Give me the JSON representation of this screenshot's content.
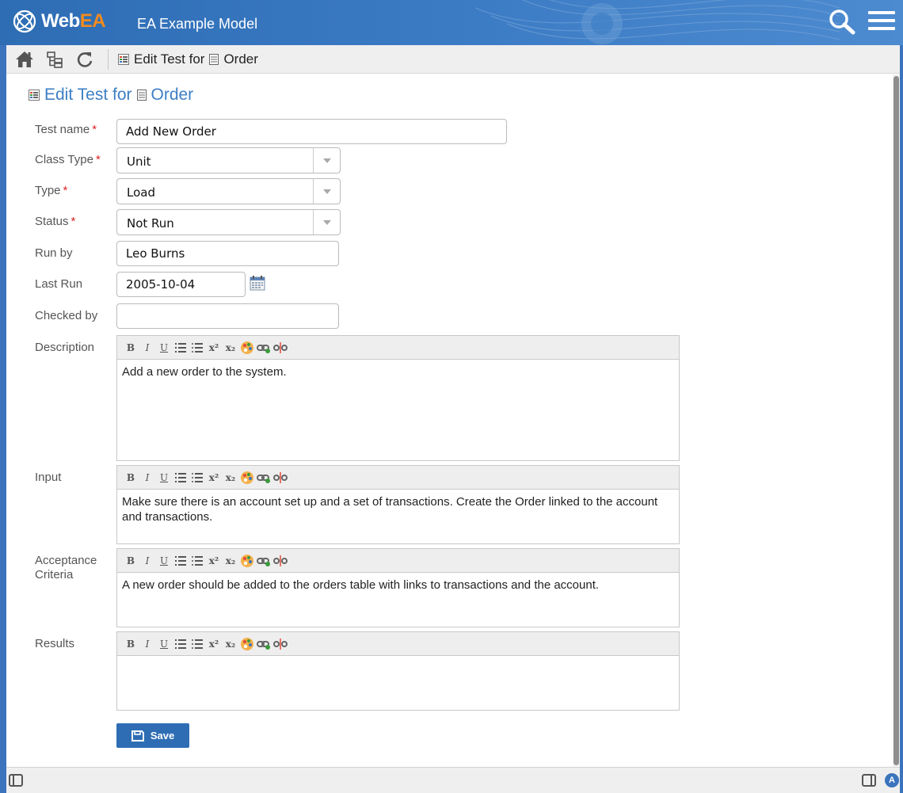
{
  "app": {
    "logo_prefix": "Web",
    "logo_suffix": "EA",
    "model_name": "EA Example Model"
  },
  "toolbar": {
    "title_prefix": "Edit Test for",
    "title_element": "Order"
  },
  "page": {
    "title_prefix": "Edit Test for",
    "title_element": "Order"
  },
  "form": {
    "test_name": {
      "label": "Test name",
      "required_marker": "*",
      "value": "Add New Order"
    },
    "class_type": {
      "label": "Class Type",
      "required_marker": "*",
      "value": "Unit"
    },
    "type": {
      "label": "Type",
      "required_marker": "*",
      "value": "Load"
    },
    "status": {
      "label": "Status",
      "required_marker": "*",
      "value": "Not Run"
    },
    "run_by": {
      "label": "Run by",
      "value": "Leo Burns"
    },
    "last_run": {
      "label": "Last Run",
      "value": "2005-10-04"
    },
    "checked_by": {
      "label": "Checked by",
      "value": ""
    },
    "description": {
      "label": "Description",
      "text": "Add a new order to the system."
    },
    "input": {
      "label": "Input",
      "text": "Make sure there is an account set up and a set of transactions. Create the Order linked to the account and transactions."
    },
    "acceptance": {
      "label_line1": "Acceptance",
      "label_line2": "Criteria",
      "text": "A new order should be added to the orders table with links to transactions and the account."
    },
    "results": {
      "label": "Results",
      "text": ""
    }
  },
  "rte_toolbar": {
    "bold": "B",
    "italic": "I",
    "underline": "U",
    "superscript": "x²",
    "subscript": "x₂"
  },
  "save_label": "Save",
  "colors": {
    "brand_blue": "#2e6db4",
    "title_blue": "#3d7fc4",
    "logo_orange": "#f28b1e",
    "required_red": "#dd2222"
  }
}
